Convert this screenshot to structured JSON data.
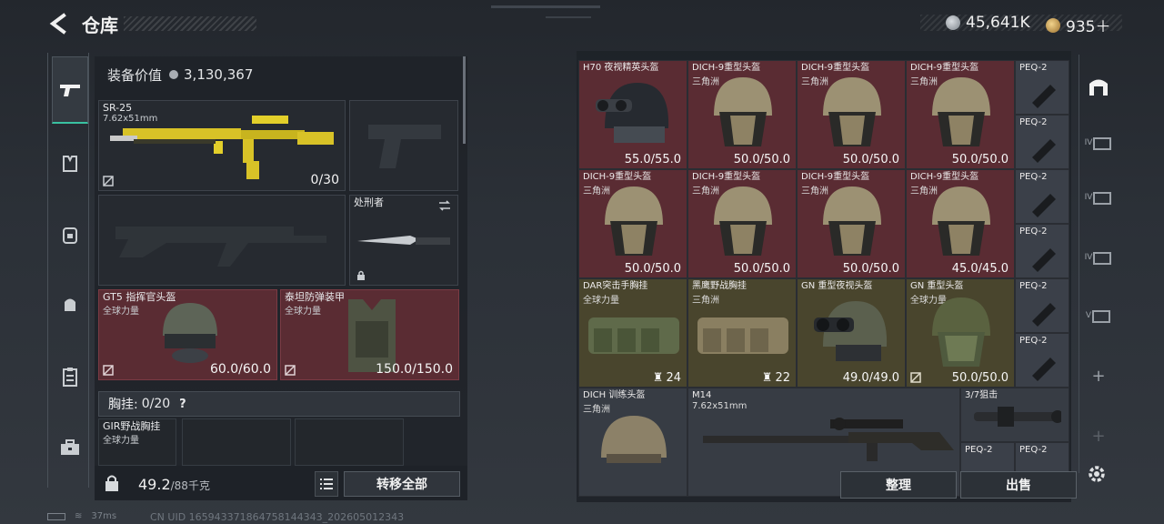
{
  "header": {
    "title": "仓库",
    "currency_1": "45,641K",
    "currency_2": "935＋"
  },
  "equipment": {
    "value_label": "装备价值",
    "value": "3,130,367",
    "primary": {
      "name": "SR-25",
      "caliber": "7.62x51mm",
      "ammo": "0/30"
    },
    "melee": {
      "name": "处刑者"
    },
    "helmet": {
      "name": "GT5 指挥官头盔",
      "origin": "全球力量",
      "durability": "60.0/60.0"
    },
    "armor": {
      "name": "泰坦防弹装甲",
      "origin": "全球力量",
      "durability": "150.0/150.0"
    },
    "chest": {
      "label": "胸挂:",
      "count": "0/20",
      "help": "?"
    },
    "chest_item": {
      "name": "GIR野战胸挂",
      "origin": "全球力量"
    },
    "weight": "49.2",
    "weight_max": "/88千克",
    "transfer_all": "转移全部"
  },
  "storage": {
    "row1": [
      {
        "name": "H70 夜视精英头盔",
        "sub": "",
        "durability": "55.0/55.0"
      },
      {
        "name": "DICH-9重型头盔",
        "sub": "三角洲",
        "durability": "50.0/50.0"
      },
      {
        "name": "DICH-9重型头盔",
        "sub": "三角洲",
        "durability": "50.0/50.0"
      },
      {
        "name": "DICH-9重型头盔",
        "sub": "三角洲",
        "durability": "50.0/50.0"
      }
    ],
    "row2": [
      {
        "name": "DICH-9重型头盔",
        "sub": "三角洲",
        "durability": "50.0/50.0"
      },
      {
        "name": "DICH-9重型头盔",
        "sub": "三角洲",
        "durability": "50.0/50.0"
      },
      {
        "name": "DICH-9重型头盔",
        "sub": "三角洲",
        "durability": "50.0/50.0"
      },
      {
        "name": "DICH-9重型头盔",
        "sub": "三角洲",
        "durability": "45.0/45.0"
      }
    ],
    "row3": [
      {
        "name": "DAR突击手胸挂",
        "sub": "全球力量",
        "stack": "24"
      },
      {
        "name": "黑鹰野战胸挂",
        "sub": "三角洲",
        "stack": "22"
      },
      {
        "name": "GN 重型夜视头盔",
        "sub": "",
        "durability": "49.0/49.0"
      },
      {
        "name": "GN 重型头盔",
        "sub": "全球力量",
        "durability": "50.0/50.0"
      }
    ],
    "row4_helmet": {
      "name": "DICH 训练头盔",
      "sub": "三角洲"
    },
    "row4_rifle": {
      "name": "M14",
      "sub": "7.62x51mm"
    },
    "scope": {
      "name": "3/7狙击"
    },
    "peq": [
      "PEQ-2",
      "PEQ-2",
      "PEQ-2",
      "PEQ-2",
      "PEQ-2",
      "PEQ-2",
      "PEQ-2",
      "PEQ-2"
    ],
    "sort_label": "整理",
    "sell_label": "出售"
  },
  "right_nav": {
    "labels": [
      "IV",
      "IV",
      "IV",
      "V"
    ]
  },
  "status": {
    "ping": "37ms",
    "uid": "CN UID 1659433718647581443​43_202605012343"
  },
  "colors": {
    "accent": "#39c1a1",
    "rare_red": "#5a2c33",
    "olive": "#49452d"
  }
}
